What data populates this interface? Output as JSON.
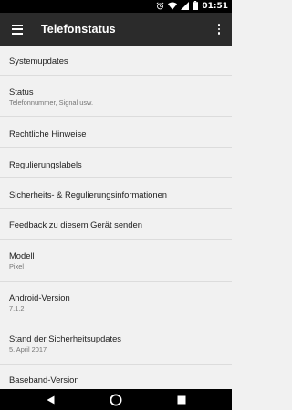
{
  "status_bar": {
    "time": "01:51",
    "icons": [
      "alarm-icon",
      "wifi-icon",
      "cellular-signal-icon",
      "battery-icon"
    ]
  },
  "app_bar": {
    "title": "Telefonstatus",
    "menu_icon": "hamburger-menu-icon",
    "overflow_icon": "more-vert-icon"
  },
  "list": {
    "items": [
      {
        "title": "Systemupdates",
        "subtitle": ""
      },
      {
        "title": "Status",
        "subtitle": "Telefonnummer, Signal usw."
      },
      {
        "title": "Rechtliche Hinweise",
        "subtitle": ""
      },
      {
        "title": "Regulierungslabels",
        "subtitle": ""
      },
      {
        "title": "Sicherheits- & Regulierungsinformationen",
        "subtitle": ""
      },
      {
        "title": "Feedback zu diesem Gerät senden",
        "subtitle": ""
      },
      {
        "title": "Modell",
        "subtitle": "Pixel"
      },
      {
        "title": "Android-Version",
        "subtitle": "7.1.2"
      },
      {
        "title": "Stand der Sicherheitsupdates",
        "subtitle": "5. April 2017"
      },
      {
        "title": "Baseband-Version",
        "subtitle": ""
      }
    ]
  },
  "nav_bar": {
    "icons": [
      "back-icon",
      "home-icon",
      "recents-icon"
    ]
  },
  "colors": {
    "app_bar": "#2b2b2b",
    "background": "#f1f1f1",
    "title_text": "#212121",
    "subtitle_text": "#757575"
  }
}
